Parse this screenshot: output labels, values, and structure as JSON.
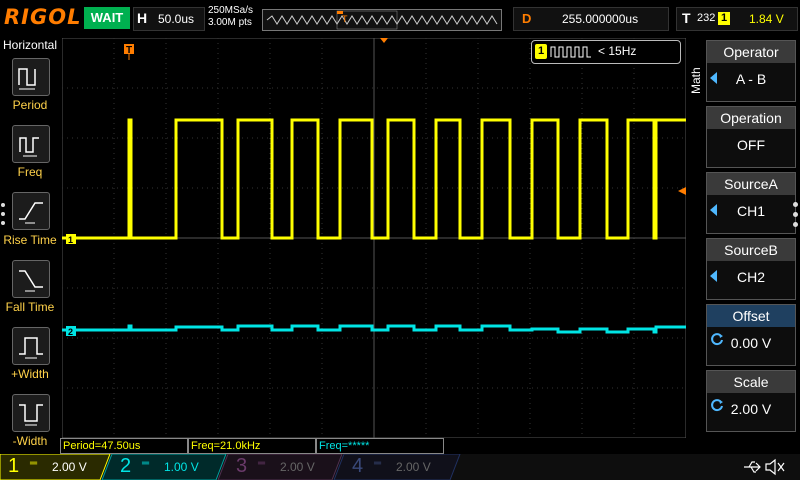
{
  "top_bar": {
    "brand": "RIGOL",
    "run_status": "WAIT",
    "horizontal": {
      "label": "H",
      "timebase": "50.0us"
    },
    "acquisition": {
      "sample_rate": "250MSa/s",
      "memory_depth": "3.00M pts"
    },
    "delay": {
      "label": "D",
      "value": "255.000000us"
    },
    "trigger": {
      "label": "T",
      "code": "232",
      "source": "1",
      "level": "1.84 V"
    }
  },
  "left_panel": {
    "title": "Horizontal",
    "items": [
      {
        "label": "Period",
        "icon": "period-icon"
      },
      {
        "label": "Freq",
        "icon": "freq-icon"
      },
      {
        "label": "Rise Time",
        "icon": "rise-time-icon"
      },
      {
        "label": "Fall Time",
        "icon": "fall-time-icon"
      },
      {
        "label": "+Width",
        "icon": "positive-width-icon"
      },
      {
        "label": "-Width",
        "icon": "negative-width-icon"
      }
    ]
  },
  "freq_indicator": {
    "channel": "1",
    "text": "< 15Hz"
  },
  "right_panel": {
    "title": "Math",
    "items": [
      {
        "header": "Operator",
        "value": "A - B"
      },
      {
        "header": "Operation",
        "value": "OFF"
      },
      {
        "header": "SourceA",
        "value": "CH1"
      },
      {
        "header": "SourceB",
        "value": "CH2"
      },
      {
        "header": "Offset",
        "value": "0.00 V"
      },
      {
        "header": "Scale",
        "value": "2.00 V"
      }
    ]
  },
  "markers": {
    "ch1": "1",
    "ch2": "2",
    "trigger_pos": "T"
  },
  "measurements": [
    "Period=47.50us",
    "Freq=21.0kHz",
    "Freq=*****"
  ],
  "channels": [
    {
      "num": "1",
      "scale": "2.00 V",
      "color": "#ffff00",
      "active": true
    },
    {
      "num": "2",
      "scale": "1.00 V",
      "color": "#00e0e0",
      "active": true
    },
    {
      "num": "3",
      "scale": "2.00 V",
      "color": "#c040c0",
      "active": false
    },
    {
      "num": "4",
      "scale": "2.00 V",
      "color": "#3060ff",
      "active": false
    }
  ],
  "colors": {
    "accent": "#ff7d00",
    "ch1": "#ffff00",
    "ch2": "#00e5e5",
    "run": "#00b050"
  }
}
